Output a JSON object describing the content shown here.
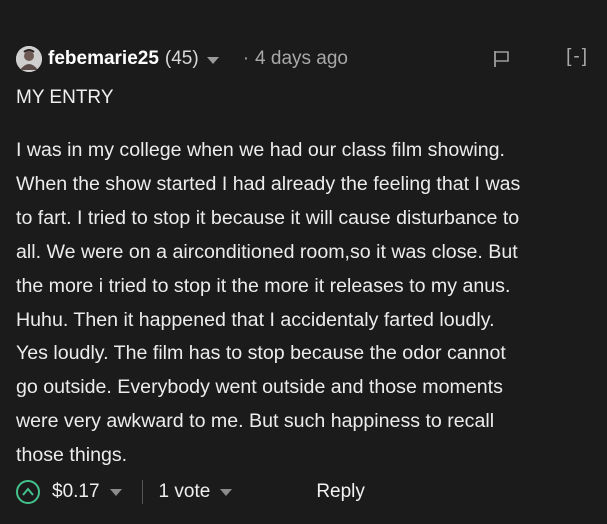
{
  "comment": {
    "author": "febemarie25",
    "reputation": "(45)",
    "separator_dot": "·",
    "time_ago": "4 days ago",
    "collapse_label": "[-]",
    "title": "MY ENTRY",
    "body_lines": [
      "I was in my college when we had our class film showing.",
      "When the show started I had already the feeling that I was",
      "to fart. I tried to stop it because it will cause disturbance to",
      "all. We were on a airconditioned room,so it was close. But",
      "the more i tried to stop it the more it releases to my anus.",
      "Huhu. Then it happened that I accidentaly farted loudly.",
      "Yes loudly. The film has to stop because the odor cannot",
      "go outside. Everybody went outside and those moments",
      "were very awkward to me. But such happiness to recall",
      "those things."
    ],
    "payout": "$0.17",
    "votes": "1 vote",
    "reply_label": "Reply"
  },
  "icons": {
    "avatar": "avatar",
    "author_menu": "chevron-down-icon",
    "flag": "flag-icon",
    "upvote": "upvote-icon",
    "payout_menu": "chevron-down-icon",
    "votes_menu": "chevron-down-icon"
  },
  "colors": {
    "background": "#1b1b1b",
    "upvote_accent": "#44c28c",
    "text_primary": "#ececec",
    "text_muted": "#a8a8a8"
  }
}
